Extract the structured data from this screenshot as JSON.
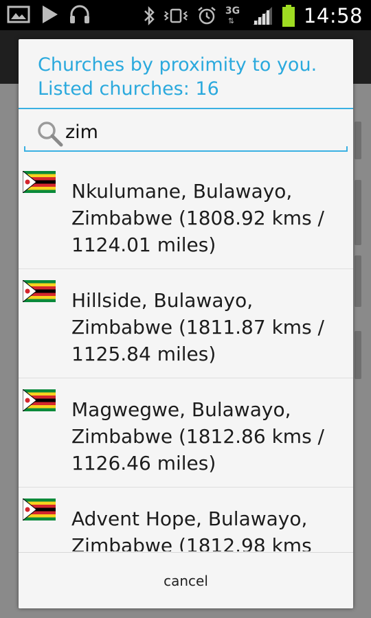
{
  "status_bar": {
    "time": "14:58",
    "network": "3G",
    "left_icons": [
      "image-icon",
      "play-icon",
      "headphones-icon"
    ],
    "right_icons": [
      "bluetooth-icon",
      "vibrate-icon",
      "alarm-icon",
      "network-3g-icon",
      "signal-icon",
      "battery-icon"
    ],
    "battery_color": "#9fdc22"
  },
  "dialog": {
    "title_line1": "Churches by proximity to you.",
    "title_line2": "Listed churches: 16",
    "search": {
      "value": "zim"
    },
    "items": [
      {
        "name": "Nkulumane, Bulawayo, Zimbabwe (1808.92 kms / 1124.01 miles)",
        "flag": "zimbabwe-flag"
      },
      {
        "name": "Hillside, Bulawayo, Zimbabwe (1811.87 kms / 1125.84 miles)",
        "flag": "zimbabwe-flag"
      },
      {
        "name": "Magwegwe, Bulawayo, Zimbabwe (1812.86 kms / 1126.46 miles)",
        "flag": "zimbabwe-flag"
      },
      {
        "name": "Advent Hope, Bulawayo, Zimbabwe (1812.98 kms",
        "flag": "zimbabwe-flag"
      }
    ],
    "cancel_label": "cancel",
    "accent_color": "#2aa9dd"
  }
}
